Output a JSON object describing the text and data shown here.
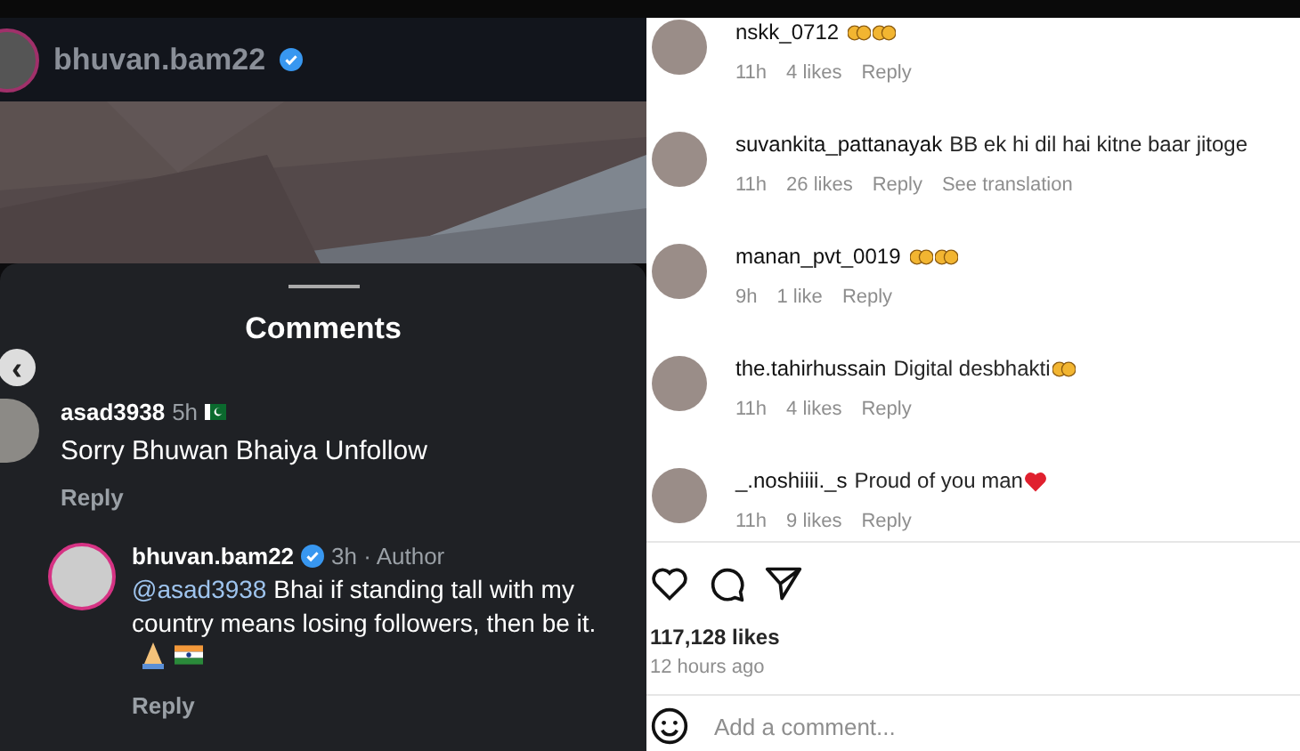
{
  "post_header": {
    "username": "bhuvan.bam22",
    "verified": true
  },
  "comments_sheet": {
    "title": "Comments",
    "back_button": "‹",
    "comment": {
      "username": "asad3938",
      "time": "5h",
      "flag": {
        "kind": "pakistan"
      },
      "text": "Sorry Bhuwan Bhaiya Unfollow",
      "reply_label": "Reply",
      "replies": [
        {
          "username": "bhuvan.bam22",
          "verified": true,
          "time": "3h · Author",
          "mention": "@asad3938",
          "text": "Bhai if standing tall with my country means losing followers, then be it.",
          "emojis": [
            {
              "kind": "pray"
            },
            {
              "kind": "india-flag"
            }
          ],
          "reply_label": "Reply"
        }
      ]
    }
  },
  "comments": [
    {
      "username": "nskk_0712",
      "emojis": [
        {
          "kind": "clap"
        },
        {
          "kind": "clap"
        }
      ],
      "time": "11h",
      "likes": "4 likes",
      "actions": [
        "Reply"
      ]
    },
    {
      "username": "suvankita_pattanayak",
      "text": "BB ek hi dil hai kitne baar jitoge",
      "time": "11h",
      "likes": "26 likes",
      "actions": [
        "Reply",
        "See translation"
      ]
    },
    {
      "username": "manan_pvt_0019",
      "emojis": [
        {
          "kind": "clap"
        },
        {
          "kind": "clap"
        }
      ],
      "time": "9h",
      "likes": "1 like",
      "actions": [
        "Reply"
      ]
    },
    {
      "username": "the.tahirhussain",
      "text": "Digital desbhakti",
      "emojis": [
        {
          "kind": "clap"
        }
      ],
      "time": "11h",
      "likes": "4 likes",
      "actions": [
        "Reply"
      ]
    },
    {
      "username": "_.noshiiii._s",
      "text": "Proud of you man",
      "emojis": [
        {
          "kind": "heart"
        }
      ],
      "time": "11h",
      "likes": "9 likes",
      "actions": [
        "Reply"
      ]
    }
  ],
  "post_footer": {
    "liked": false,
    "likes": "117,128 likes",
    "time": "12 hours ago",
    "comment_field": {
      "placeholder": "Add a comment..."
    }
  }
}
